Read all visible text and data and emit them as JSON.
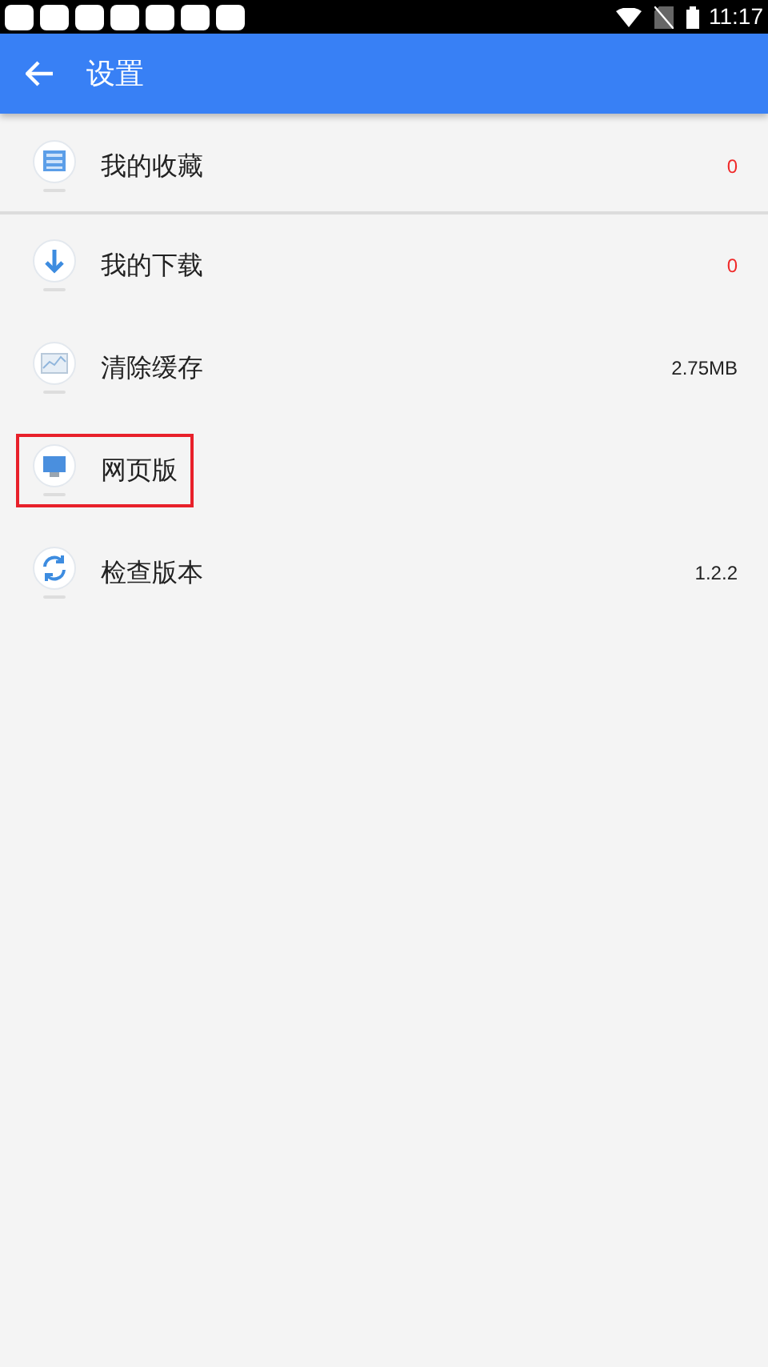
{
  "status_bar": {
    "time": "11:17"
  },
  "app_bar": {
    "title": "设置"
  },
  "items": [
    {
      "label": "我的收藏",
      "value": "0",
      "kind": "count",
      "highlighted": false
    },
    {
      "label": "我的下载",
      "value": "0",
      "kind": "count",
      "highlighted": false
    },
    {
      "label": "清除缓存",
      "value": "2.75MB",
      "kind": "info",
      "highlighted": false
    },
    {
      "label": "网页版",
      "highlighted": true
    },
    {
      "label": "检查版本",
      "value": "1.2.2",
      "kind": "info",
      "highlighted": false
    }
  ]
}
